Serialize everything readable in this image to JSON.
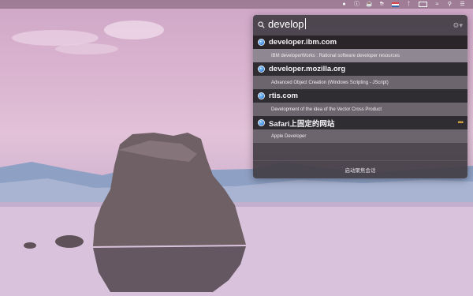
{
  "search": {
    "query": "develop"
  },
  "results": [
    {
      "title": "developer.ibm.com",
      "subtitle": "IBM developerWorks : Rational software developer resources",
      "selected": true
    },
    {
      "title": "developer.mozilla.org",
      "subtitle": "Advanced Object Creation (Windows Scripting - JScript)",
      "selected": false
    },
    {
      "title": "rtis.com",
      "subtitle": "Development of the idea of the Vector Cross Product",
      "selected": false
    },
    {
      "title": "Safari上固定的网站",
      "subtitle": "Apple Developer",
      "selected": false,
      "more": "•••"
    }
  ],
  "footer": {
    "label": "启动聚焦会话"
  },
  "menubar": {
    "icons": [
      "evernote-icon",
      "info-icon",
      "cup-icon",
      "docker-icon",
      "flag-icon",
      "bluetooth-icon",
      "keyboard-icon",
      "wifi-icon",
      "spotlight-icon",
      "list-icon"
    ]
  },
  "colors": {
    "panel": "#443e46",
    "selected_row": "#292529",
    "accent_more": "#e9b540"
  }
}
